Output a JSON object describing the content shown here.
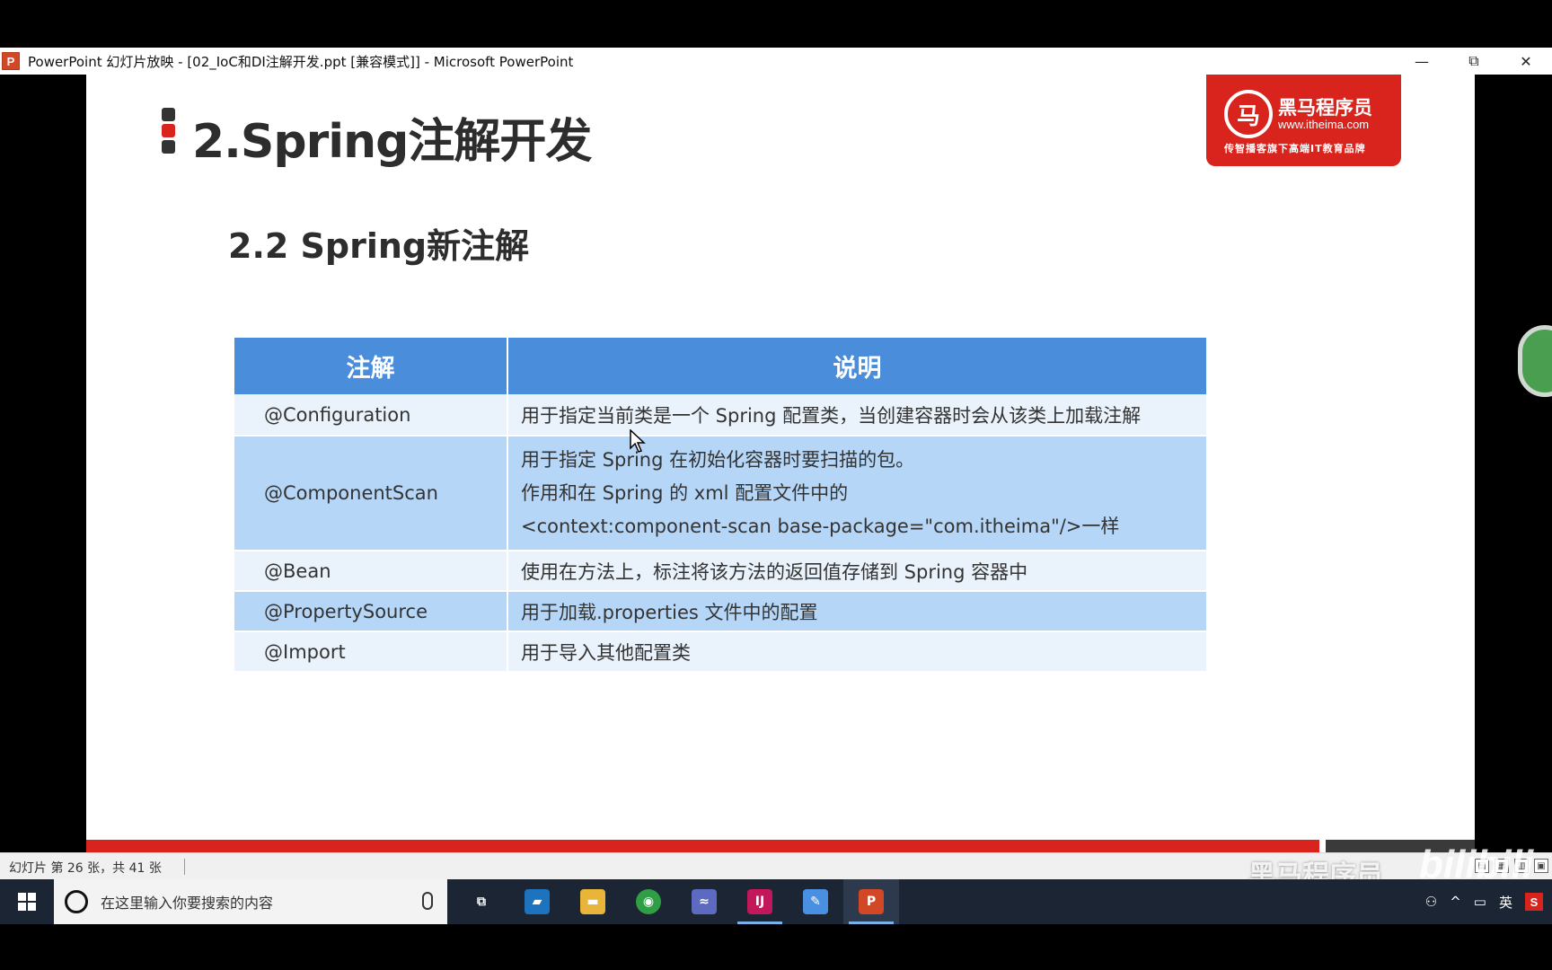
{
  "window": {
    "app_icon": "P",
    "title": "PowerPoint 幻灯片放映 - [02_IoC和DI注解开发.ppt [兼容模式]] - Microsoft PowerPoint",
    "minimize": "—",
    "restore": "⧉",
    "close": "✕"
  },
  "slide": {
    "title": "2.Spring注解开发",
    "subtitle": "2.2 Spring新注解",
    "logo": {
      "mark": "马",
      "name": "黑马程序员",
      "url": "www.itheima.com",
      "slogan": "传智播客旗下高端IT教育品牌"
    },
    "table": {
      "headers": [
        "注解",
        "说明"
      ],
      "rows": [
        {
          "annotation": "@Configuration",
          "desc": [
            "用于指定当前类是一个 Spring 配置类，当创建容器时会从该类上加载注解"
          ]
        },
        {
          "annotation": "@ComponentScan",
          "desc": [
            "用于指定 Spring 在初始化容器时要扫描的包。",
            "作用和在 Spring 的 xml 配置文件中的",
            "<context:component-scan base-package=\"com.itheima\"/>一样"
          ]
        },
        {
          "annotation": "@Bean",
          "desc": [
            "使用在方法上，标注将该方法的返回值存储到 Spring 容器中"
          ]
        },
        {
          "annotation": "@PropertySource",
          "desc": [
            "用于加载.properties 文件中的配置"
          ]
        },
        {
          "annotation": "@Import",
          "desc": [
            "用于导入其他配置类"
          ]
        }
      ]
    }
  },
  "statusbar": {
    "slide_info": "幻灯片 第 26 张，共 41 张"
  },
  "watermark": {
    "text": "黑马程序员",
    "bilibili": "bilibili"
  },
  "taskbar": {
    "search_placeholder": "在这里输入你要搜索的内容",
    "apps": [
      {
        "name": "task-view-icon",
        "glyph": "⧉",
        "color": "transparent"
      },
      {
        "name": "remote-desktop-icon",
        "glyph": "▰",
        "color": "#1e73be"
      },
      {
        "name": "file-explorer-icon",
        "glyph": "▬",
        "color": "#e8b53a"
      },
      {
        "name": "chrome-icon",
        "glyph": "◉",
        "color": "#2f9e44"
      },
      {
        "name": "dolphin-icon",
        "glyph": "≈",
        "color": "#5c6bc0"
      },
      {
        "name": "intellij-icon",
        "glyph": "IJ",
        "color": "#c2185b"
      },
      {
        "name": "paint-icon",
        "glyph": "✎",
        "color": "#4a90e2"
      },
      {
        "name": "powerpoint-icon",
        "glyph": "P",
        "color": "#d24726"
      }
    ],
    "tray_ime": "英",
    "tray_s": "S"
  }
}
